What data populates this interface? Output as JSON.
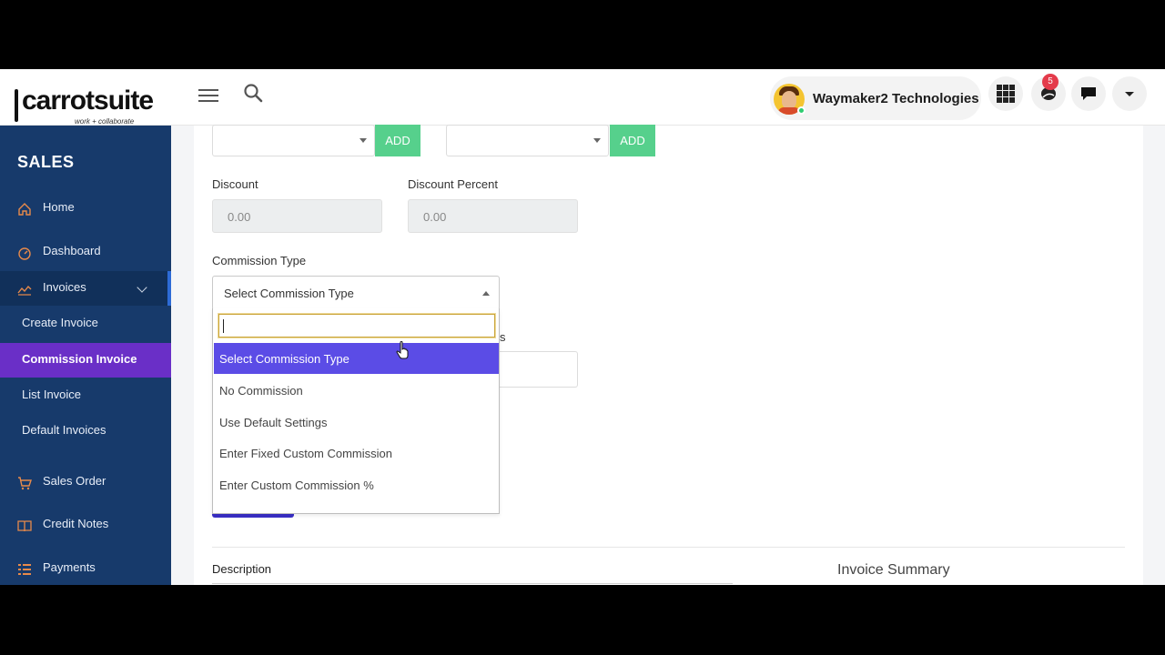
{
  "header": {
    "logo_text": "carrotsuite",
    "logo_tagline": "work + collaborate",
    "company_name": "Waymaker2 Technologies",
    "notification_count": "5"
  },
  "sidebar": {
    "section_title": "SALES",
    "items": [
      {
        "label": "Home",
        "icon": "home-icon"
      },
      {
        "label": "Dashboard",
        "icon": "dashboard-icon"
      },
      {
        "label": "Invoices",
        "icon": "invoices-icon"
      },
      {
        "label": "Create Invoice"
      },
      {
        "label": "Commission Invoice"
      },
      {
        "label": "List Invoice"
      },
      {
        "label": "Default Invoices"
      },
      {
        "label": "Sales Order",
        "icon": "cart-icon"
      },
      {
        "label": "Credit Notes",
        "icon": "book-icon"
      },
      {
        "label": "Payments",
        "icon": "list-icon"
      }
    ]
  },
  "form": {
    "add_label_1": "ADD",
    "add_label_2": "ADD",
    "discount_label": "Discount",
    "discount_value": "0.00",
    "discount_percent_label": "Discount Percent",
    "discount_percent_value": "0.00",
    "commission_type_label": "Commission Type",
    "commission_type_value": "Select Commission Type",
    "hidden_label_tail": "s",
    "description_label": "Description",
    "invoice_summary_label": "Invoice Summary"
  },
  "dropdown": {
    "search_value": "",
    "options": [
      "Select Commission Type",
      "No Commission",
      "Use Default Settings",
      "Enter Fixed Custom Commission",
      "Enter Custom Commission %"
    ],
    "selected_index": 0
  },
  "colors": {
    "sidebar_bg": "#173a6b",
    "active_item": "#6a2fc7",
    "add_button": "#56d08c",
    "option_highlight": "#5b4ce6",
    "badge": "#e43b4b"
  }
}
